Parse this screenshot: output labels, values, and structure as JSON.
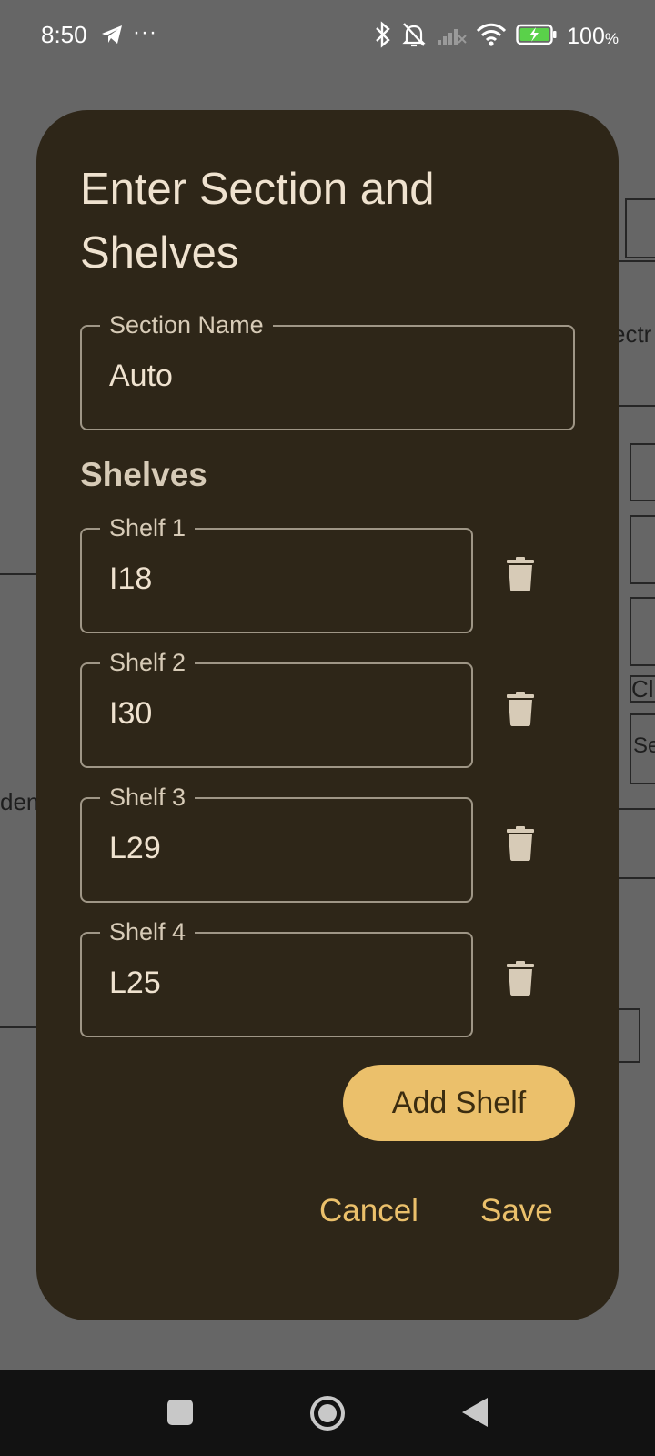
{
  "status_bar": {
    "time": "8:50",
    "battery_percent": "100",
    "battery_unit": "%",
    "icons": [
      "telegram-icon",
      "more-icon",
      "bluetooth-icon",
      "mute-icon",
      "signal-icon",
      "wifi-icon",
      "battery-charging-icon"
    ]
  },
  "background": {
    "fragment_texts": [
      "ectr",
      "den",
      "Cl",
      "Se"
    ]
  },
  "dialog": {
    "title": "Enter Section and Shelves",
    "section_name_label": "Section Name",
    "section_name_value": "Auto",
    "shelves_heading": "Shelves",
    "shelves": [
      {
        "label": "Shelf 1",
        "value": "I18"
      },
      {
        "label": "Shelf 2",
        "value": "I30"
      },
      {
        "label": "Shelf 3",
        "value": "L29"
      },
      {
        "label": "Shelf 4",
        "value": "L25"
      }
    ],
    "add_shelf_label": "Add Shelf",
    "cancel_label": "Cancel",
    "save_label": "Save"
  },
  "colors": {
    "scrim": "#666666",
    "dialog_bg": "#2e2618",
    "accent": "#ebc06b",
    "text_primary": "#efe2cf",
    "text_secondary": "#d7cbb7",
    "outline": "#9f9686",
    "nav_bar": "#121212"
  }
}
